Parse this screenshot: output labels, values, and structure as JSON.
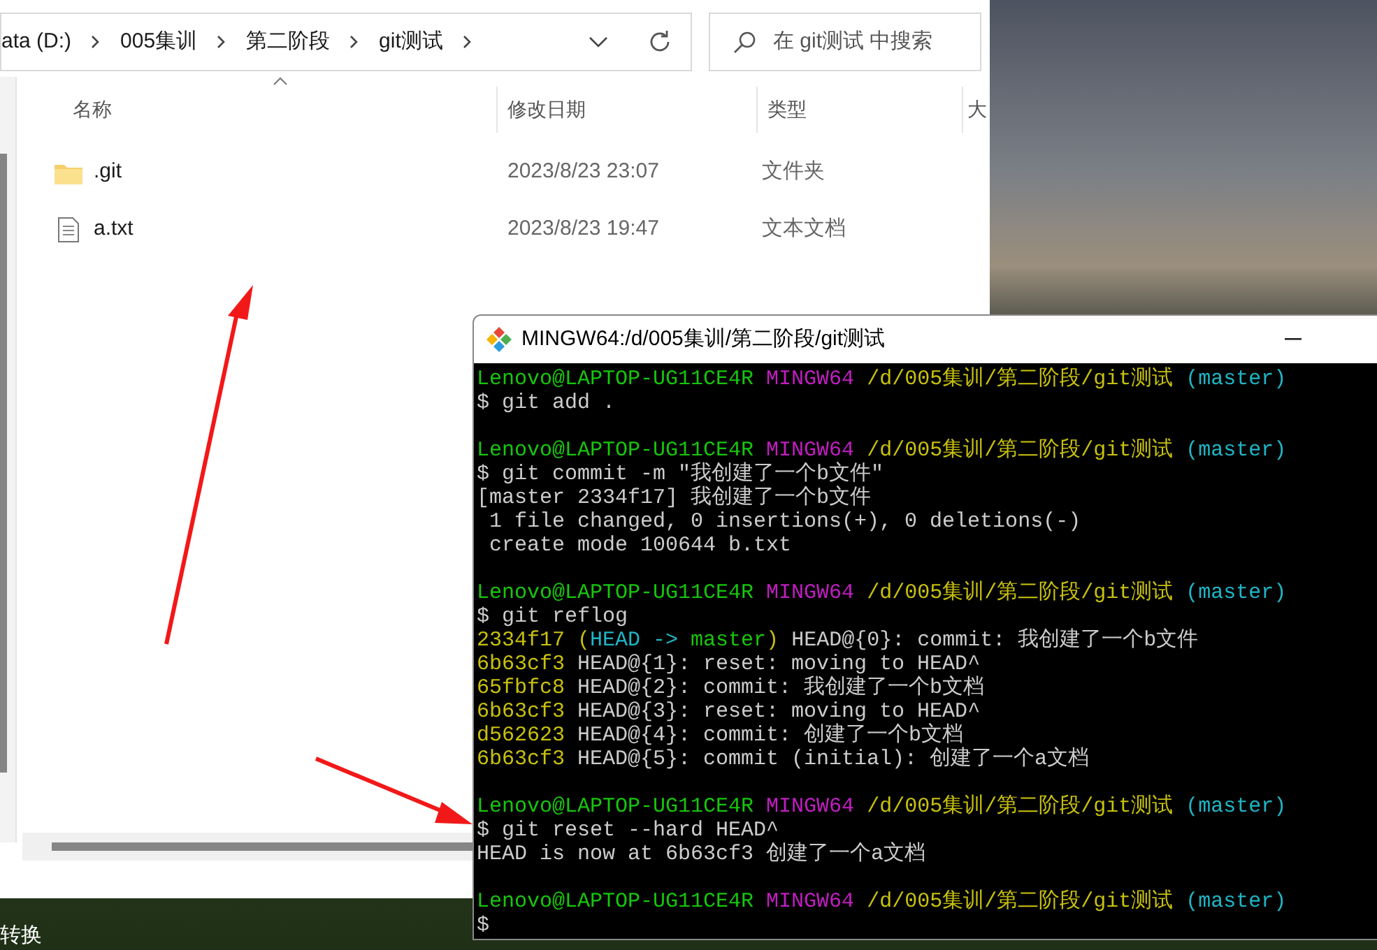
{
  "explorer": {
    "breadcrumbs": [
      "ata (D:)",
      "005集训",
      "第二阶段",
      "git测试"
    ],
    "search": {
      "placeholder": "在 git测试 中搜索"
    },
    "columns": [
      "名称",
      "修改日期",
      "类型",
      "大"
    ],
    "files": [
      {
        "kind": "folder",
        "name": ".git",
        "modified": "2023/8/23 23:07",
        "type": "文件夹"
      },
      {
        "kind": "text",
        "name": "a.txt",
        "modified": "2023/8/23 19:47",
        "type": "文本文档"
      }
    ]
  },
  "desktop": {
    "icon_label": "转换"
  },
  "terminal": {
    "title": "MINGW64:/d/005集训/第二阶段/git测试",
    "lines": [
      {
        "kind": "text",
        "segments": [
          {
            "text": "Lenovo@LAPTOP-UG11CE4R ",
            "color": "#16c60c"
          },
          {
            "text": "MINGW64 ",
            "color": "#c11ec1"
          },
          {
            "text": "/d/005集训/第二阶段/git测试 ",
            "color": "#c8c10e"
          },
          {
            "text": "(master)",
            "color": "#1fb6c6"
          }
        ]
      },
      {
        "kind": "text",
        "segments": [
          {
            "text": "$ git add .",
            "color": "#cccccc"
          }
        ]
      },
      {
        "kind": "blank"
      },
      {
        "kind": "text",
        "segments": [
          {
            "text": "Lenovo@LAPTOP-UG11CE4R ",
            "color": "#16c60c"
          },
          {
            "text": "MINGW64 ",
            "color": "#c11ec1"
          },
          {
            "text": "/d/005集训/第二阶段/git测试 ",
            "color": "#c8c10e"
          },
          {
            "text": "(master)",
            "color": "#1fb6c6"
          }
        ]
      },
      {
        "kind": "text",
        "segments": [
          {
            "text": "$ git commit -m \"我创建了一个b文件\"",
            "color": "#cccccc"
          }
        ]
      },
      {
        "kind": "text",
        "segments": [
          {
            "text": "[master 2334f17] 我创建了一个b文件",
            "color": "#cccccc"
          }
        ]
      },
      {
        "kind": "text",
        "segments": [
          {
            "text": " 1 file changed, 0 insertions(+), 0 deletions(-)",
            "color": "#cccccc"
          }
        ]
      },
      {
        "kind": "text",
        "segments": [
          {
            "text": " create mode 100644 b.txt",
            "color": "#cccccc"
          }
        ]
      },
      {
        "kind": "blank"
      },
      {
        "kind": "text",
        "segments": [
          {
            "text": "Lenovo@LAPTOP-UG11CE4R ",
            "color": "#16c60c"
          },
          {
            "text": "MINGW64 ",
            "color": "#c11ec1"
          },
          {
            "text": "/d/005集训/第二阶段/git测试 ",
            "color": "#c8c10e"
          },
          {
            "text": "(master)",
            "color": "#1fb6c6"
          }
        ]
      },
      {
        "kind": "text",
        "segments": [
          {
            "text": "$ git reflog",
            "color": "#cccccc"
          }
        ]
      },
      {
        "kind": "text",
        "segments": [
          {
            "text": "2334f17 (",
            "color": "#c8c10e"
          },
          {
            "text": "HEAD -> ",
            "color": "#1fb6c6"
          },
          {
            "text": "master",
            "color": "#16c60c"
          },
          {
            "text": ")",
            "color": "#c8c10e"
          },
          {
            "text": " HEAD@{0}: commit: 我创建了一个b文件",
            "color": "#cccccc"
          }
        ]
      },
      {
        "kind": "text",
        "segments": [
          {
            "text": "6b63cf3",
            "color": "#c8c10e"
          },
          {
            "text": " HEAD@{1}: reset: moving to HEAD^",
            "color": "#cccccc"
          }
        ]
      },
      {
        "kind": "text",
        "segments": [
          {
            "text": "65fbfc8",
            "color": "#c8c10e"
          },
          {
            "text": " HEAD@{2}: commit: 我创建了一个b文档",
            "color": "#cccccc"
          }
        ]
      },
      {
        "kind": "text",
        "segments": [
          {
            "text": "6b63cf3",
            "color": "#c8c10e"
          },
          {
            "text": " HEAD@{3}: reset: moving to HEAD^",
            "color": "#cccccc"
          }
        ]
      },
      {
        "kind": "text",
        "segments": [
          {
            "text": "d562623",
            "color": "#c8c10e"
          },
          {
            "text": " HEAD@{4}: commit: 创建了一个b文档",
            "color": "#cccccc"
          }
        ]
      },
      {
        "kind": "text",
        "segments": [
          {
            "text": "6b63cf3",
            "color": "#c8c10e"
          },
          {
            "text": " HEAD@{5}: commit (initial): 创建了一个a文档",
            "color": "#cccccc"
          }
        ]
      },
      {
        "kind": "blank"
      },
      {
        "kind": "text",
        "segments": [
          {
            "text": "Lenovo@LAPTOP-UG11CE4R ",
            "color": "#16c60c"
          },
          {
            "text": "MINGW64 ",
            "color": "#c11ec1"
          },
          {
            "text": "/d/005集训/第二阶段/git测试 ",
            "color": "#c8c10e"
          },
          {
            "text": "(master)",
            "color": "#1fb6c6"
          }
        ]
      },
      {
        "kind": "text",
        "segments": [
          {
            "text": "$ git reset --hard HEAD^",
            "color": "#cccccc"
          }
        ]
      },
      {
        "kind": "text",
        "segments": [
          {
            "text": "HEAD is now at 6b63cf3 创建了一个a文档",
            "color": "#cccccc"
          }
        ]
      },
      {
        "kind": "blank"
      },
      {
        "kind": "text",
        "segments": [
          {
            "text": "Lenovo@LAPTOP-UG11CE4R ",
            "color": "#16c60c"
          },
          {
            "text": "MINGW64 ",
            "color": "#c11ec1"
          },
          {
            "text": "/d/005集训/第二阶段/git测试 ",
            "color": "#c8c10e"
          },
          {
            "text": "(master)",
            "color": "#1fb6c6"
          }
        ]
      },
      {
        "kind": "text",
        "segments": [
          {
            "text": "$",
            "color": "#cccccc"
          }
        ]
      }
    ]
  }
}
